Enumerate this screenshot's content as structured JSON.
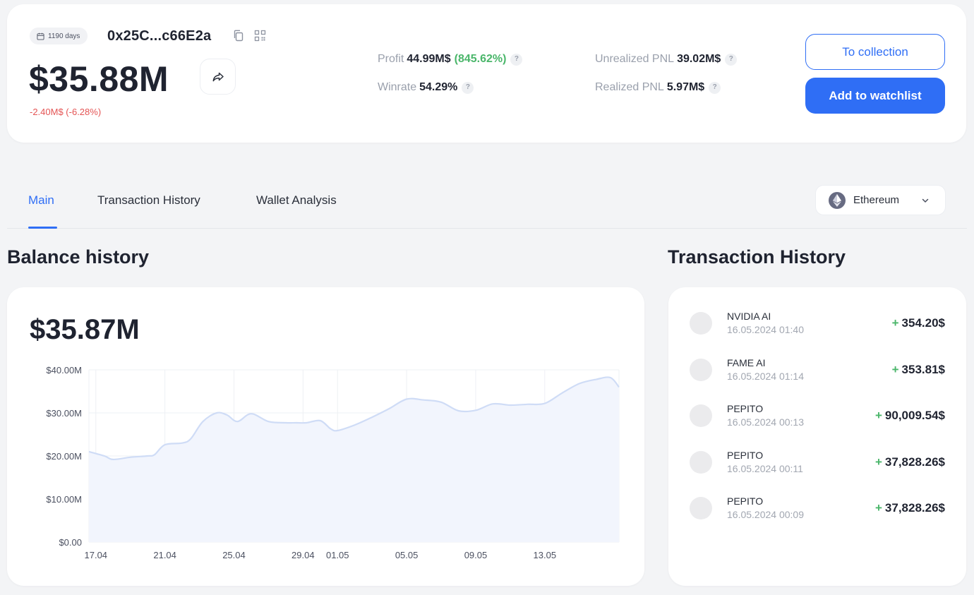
{
  "wallet": {
    "age_badge": "1190 days",
    "address": "0x25C...c66E2a",
    "balance": "$35.88M",
    "balance_change": "-2.40M$ (-6.28%)"
  },
  "stats": {
    "profit": {
      "label": "Profit",
      "value": "44.99M$",
      "percent": "(845.62%)"
    },
    "winrate": {
      "label": "Winrate",
      "value": "54.29%"
    },
    "unrealized": {
      "label": "Unrealized PNL",
      "value": "39.02M$"
    },
    "realized": {
      "label": "Realized PNL",
      "value": "5.97M$"
    },
    "help_glyph": "?"
  },
  "actions": {
    "to_collection": "To collection",
    "add_watchlist": "Add to watchlist"
  },
  "tabs": [
    {
      "label": "Main",
      "active": true
    },
    {
      "label": "Transaction History",
      "active": false
    },
    {
      "label": "Wallet Analysis",
      "active": false
    }
  ],
  "network": {
    "selected": "Ethereum",
    "icon": "ethereum-icon"
  },
  "sections": {
    "balance_title": "Balance history",
    "tx_title": "Transaction History"
  },
  "chart_value": "$35.87M",
  "chart_data": {
    "type": "area",
    "title": "",
    "xlabel": "",
    "ylabel": "",
    "ylim": [
      0,
      40000000
    ],
    "y_ticks": [
      0,
      10000000,
      20000000,
      30000000,
      40000000
    ],
    "y_tick_labels": [
      "$0.00",
      "$10.00M",
      "$20.00M",
      "$30.00M",
      "$40.00M"
    ],
    "x_tick_labels": [
      "17.04",
      "21.04",
      "25.04",
      "29.04",
      "01.05",
      "05.05",
      "09.05",
      "13.05"
    ],
    "x_tick_days": [
      0,
      4,
      8,
      12,
      14,
      18,
      22,
      26
    ],
    "grid": true,
    "line_color": "#cfdcf6",
    "fill_color": "#f2f5fd",
    "series": [
      {
        "x": [
          -0.4,
          0.5,
          1.0,
          2.0,
          3.0,
          3.4,
          4.0,
          5.0,
          5.5,
          6.2,
          7.0,
          7.6,
          8.2,
          9.0,
          10.0,
          11.0,
          11.6,
          12.2,
          13.0,
          13.6,
          14.0,
          15.0,
          16.0,
          17.0,
          18.0,
          19.0,
          20.0,
          21.0,
          22.0,
          23.0,
          24.0,
          25.0,
          26.0,
          27.0,
          28.0,
          29.0,
          29.8,
          30.3
        ],
        "values": [
          21000000,
          20000000,
          19200000,
          19700000,
          20000000,
          20300000,
          22600000,
          23000000,
          24000000,
          28000000,
          30000000,
          29500000,
          28000000,
          29800000,
          28000000,
          27700000,
          27700000,
          27700000,
          28200000,
          26300000,
          25900000,
          27200000,
          29000000,
          31000000,
          33200000,
          33000000,
          32500000,
          30500000,
          30600000,
          32100000,
          31800000,
          32000000,
          32200000,
          34600000,
          36800000,
          37800000,
          38200000,
          36000000
        ]
      }
    ]
  },
  "transactions": [
    {
      "name": "NVIDIA AI",
      "date": "16.05.2024 01:40",
      "amount": "354.20$"
    },
    {
      "name": "FAME AI",
      "date": "16.05.2024 01:14",
      "amount": "353.81$"
    },
    {
      "name": "PEPITO",
      "date": "16.05.2024 00:13",
      "amount": "90,009.54$"
    },
    {
      "name": "PEPITO",
      "date": "16.05.2024 00:11",
      "amount": "37,828.26$"
    },
    {
      "name": "PEPITO",
      "date": "16.05.2024 00:09",
      "amount": "37,828.26$"
    }
  ],
  "tx_plus_glyph": "+"
}
